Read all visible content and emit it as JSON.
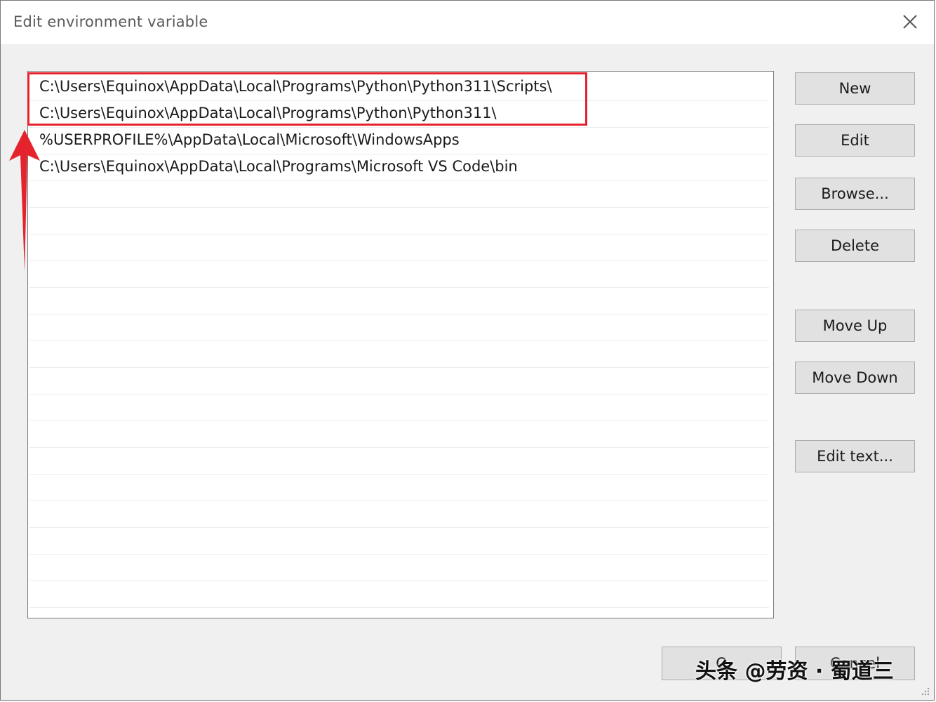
{
  "window": {
    "title": "Edit environment variable"
  },
  "list": {
    "items": [
      "C:\\Users\\Equinox\\AppData\\Local\\Programs\\Python\\Python311\\Scripts\\",
      "C:\\Users\\Equinox\\AppData\\Local\\Programs\\Python\\Python311\\",
      "%USERPROFILE%\\AppData\\Local\\Microsoft\\WindowsApps",
      "C:\\Users\\Equinox\\AppData\\Local\\Programs\\Microsoft VS Code\\bin"
    ]
  },
  "buttons": {
    "new": "New",
    "edit": "Edit",
    "browse": "Browse...",
    "delete": "Delete",
    "move_up": "Move Up",
    "move_down": "Move Down",
    "edit_text": "Edit text...",
    "ok": "O",
    "cancel": "Cancel"
  },
  "watermark": "头条 @劳资 · 蜀道三",
  "colors": {
    "annotation": "#e5232c"
  }
}
